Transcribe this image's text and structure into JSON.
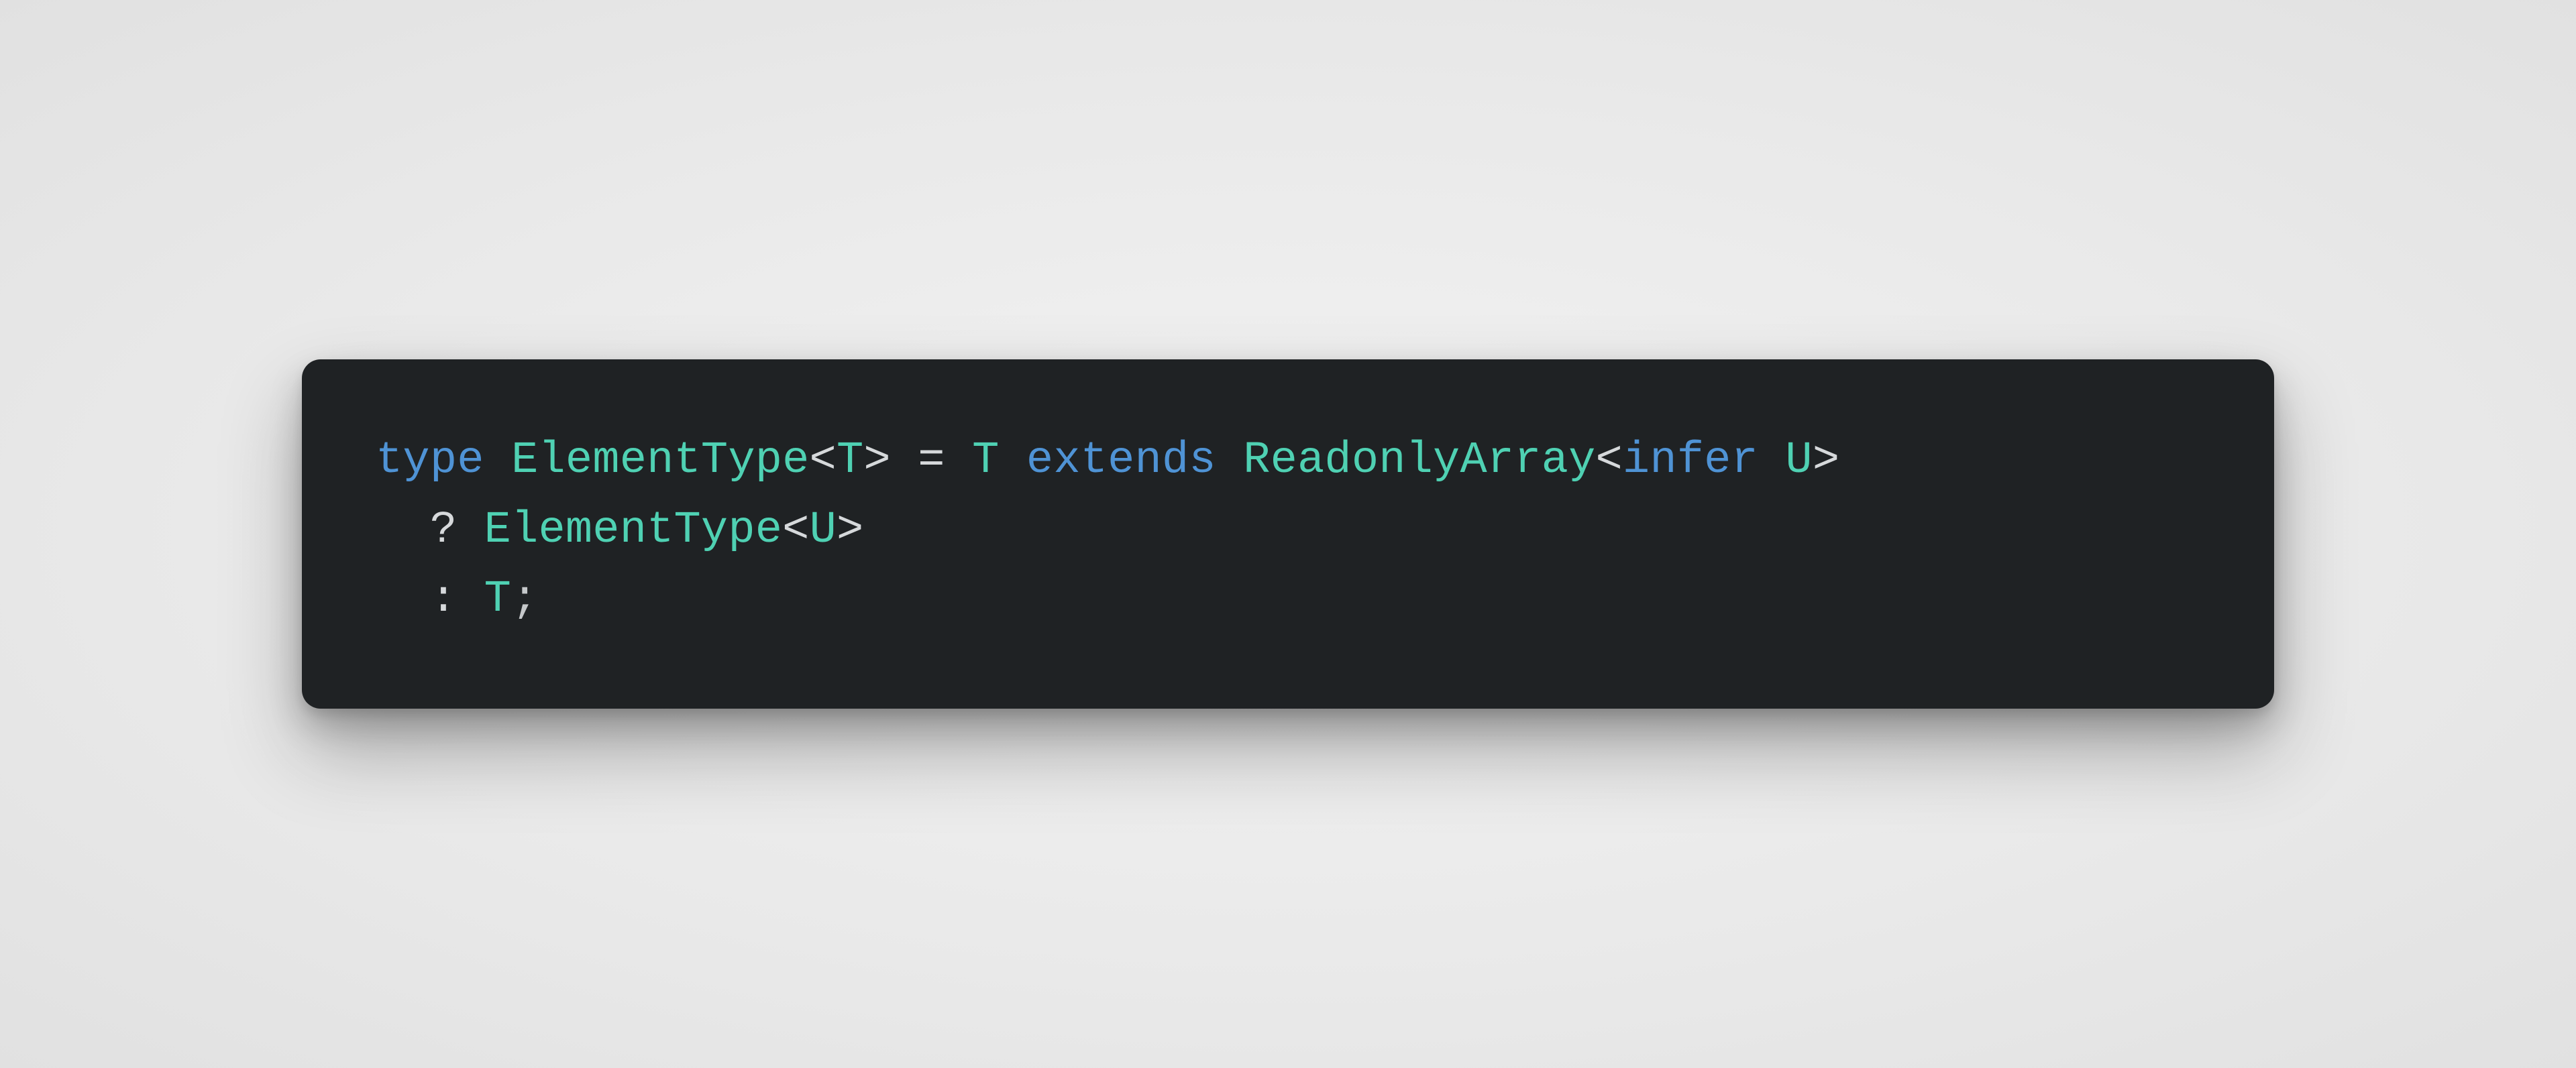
{
  "code": {
    "language": "typescript",
    "plain": "type ElementType<T> = T extends ReadonlyArray<infer U>\n  ? ElementType<U>\n  : T;",
    "lines": [
      {
        "indent": "",
        "tokens": [
          {
            "t": "type",
            "c": "tok-keyword"
          },
          {
            "t": " ",
            "c": ""
          },
          {
            "t": "ElementType",
            "c": "tok-typename"
          },
          {
            "t": "<",
            "c": "tok-angle"
          },
          {
            "t": "T",
            "c": "tok-typeparam"
          },
          {
            "t": ">",
            "c": "tok-angle"
          },
          {
            "t": " ",
            "c": ""
          },
          {
            "t": "=",
            "c": "tok-op"
          },
          {
            "t": " ",
            "c": ""
          },
          {
            "t": "T",
            "c": "tok-typeparam"
          },
          {
            "t": " ",
            "c": ""
          },
          {
            "t": "extends",
            "c": "tok-keyword"
          },
          {
            "t": " ",
            "c": ""
          },
          {
            "t": "ReadonlyArray",
            "c": "tok-typename"
          },
          {
            "t": "<",
            "c": "tok-angle"
          },
          {
            "t": "infer",
            "c": "tok-keyword"
          },
          {
            "t": " ",
            "c": ""
          },
          {
            "t": "U",
            "c": "tok-typeparam"
          },
          {
            "t": ">",
            "c": "tok-angle"
          }
        ]
      },
      {
        "indent": "  ",
        "tokens": [
          {
            "t": "?",
            "c": "tok-op"
          },
          {
            "t": " ",
            "c": ""
          },
          {
            "t": "ElementType",
            "c": "tok-typename"
          },
          {
            "t": "<",
            "c": "tok-angle"
          },
          {
            "t": "U",
            "c": "tok-typeparam"
          },
          {
            "t": ">",
            "c": "tok-angle"
          }
        ]
      },
      {
        "indent": "  ",
        "tokens": [
          {
            "t": ":",
            "c": "tok-op"
          },
          {
            "t": " ",
            "c": ""
          },
          {
            "t": "T",
            "c": "tok-typeparam"
          },
          {
            "t": ";",
            "c": "tok-punct"
          }
        ]
      }
    ]
  }
}
